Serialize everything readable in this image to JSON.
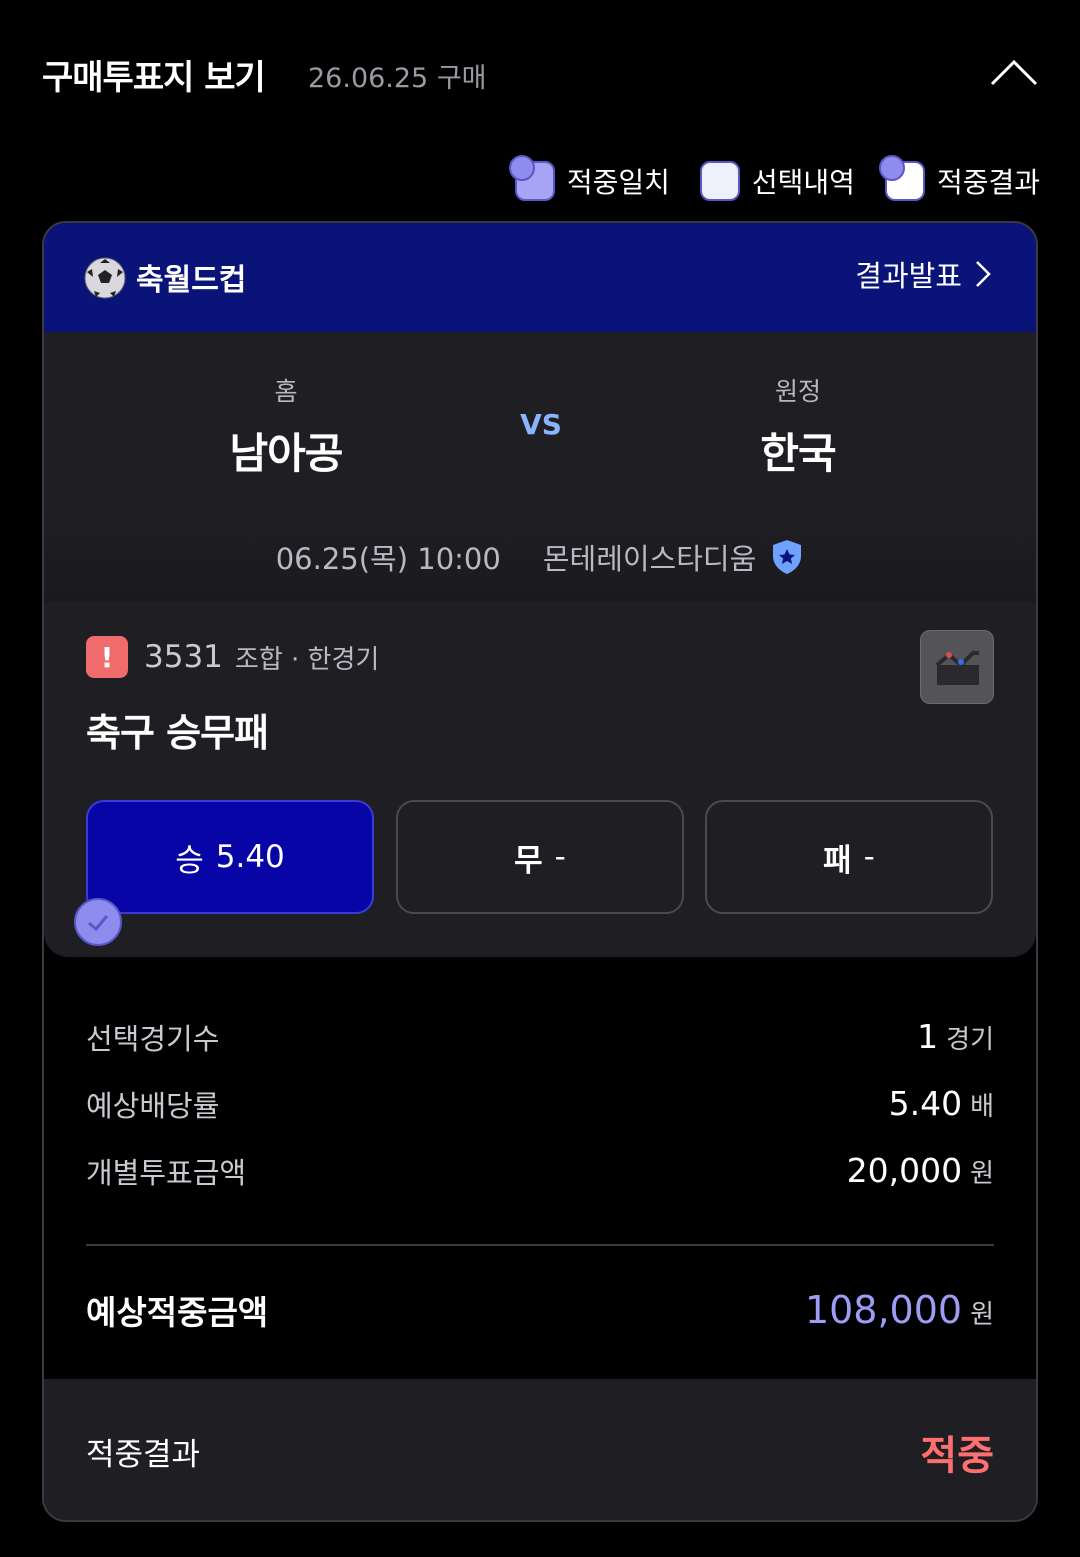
{
  "header": {
    "title": "구매투표지 보기",
    "date": "26.06.25 구매"
  },
  "legend": [
    {
      "label": "적중일치",
      "color": "#a8a4f5"
    },
    {
      "label": "선택내역",
      "color": "#eef0fb"
    },
    {
      "label": "적중결과",
      "color": "#ffffff"
    }
  ],
  "card": {
    "league": "축월드컵",
    "result_link": "결과발표",
    "home": {
      "role": "홈",
      "name": "남아공"
    },
    "vs": "VS",
    "away": {
      "role": "원정",
      "name": "한국"
    },
    "datetime": "06.25(목) 10:00",
    "venue": "몬테레이스타디움",
    "game_no": "3531",
    "game_type": "조합 · 한경기",
    "bet_title": "축구 승무패",
    "odds": [
      {
        "label": "승",
        "value": "5.40",
        "selected": true
      },
      {
        "label": "무",
        "value": "-",
        "selected": false
      },
      {
        "label": "패",
        "value": "-",
        "selected": false
      }
    ],
    "summary": {
      "count_label": "선택경기수",
      "count_value": "1",
      "count_unit": "경기",
      "rate_label": "예상배당률",
      "rate_value": "5.40",
      "rate_unit": "배",
      "amount_label": "개별투표금액",
      "amount_value": "20,000",
      "amount_unit": "원",
      "expected_label": "예상적중금액",
      "expected_value": "108,000",
      "expected_unit": "원"
    },
    "result_label": "적중결과",
    "result_value": "적중"
  },
  "colors": {
    "accent": "#0805a6",
    "header_bg": "#0a1478",
    "hit": "#ff6f6f",
    "expected": "#9d9df7"
  }
}
